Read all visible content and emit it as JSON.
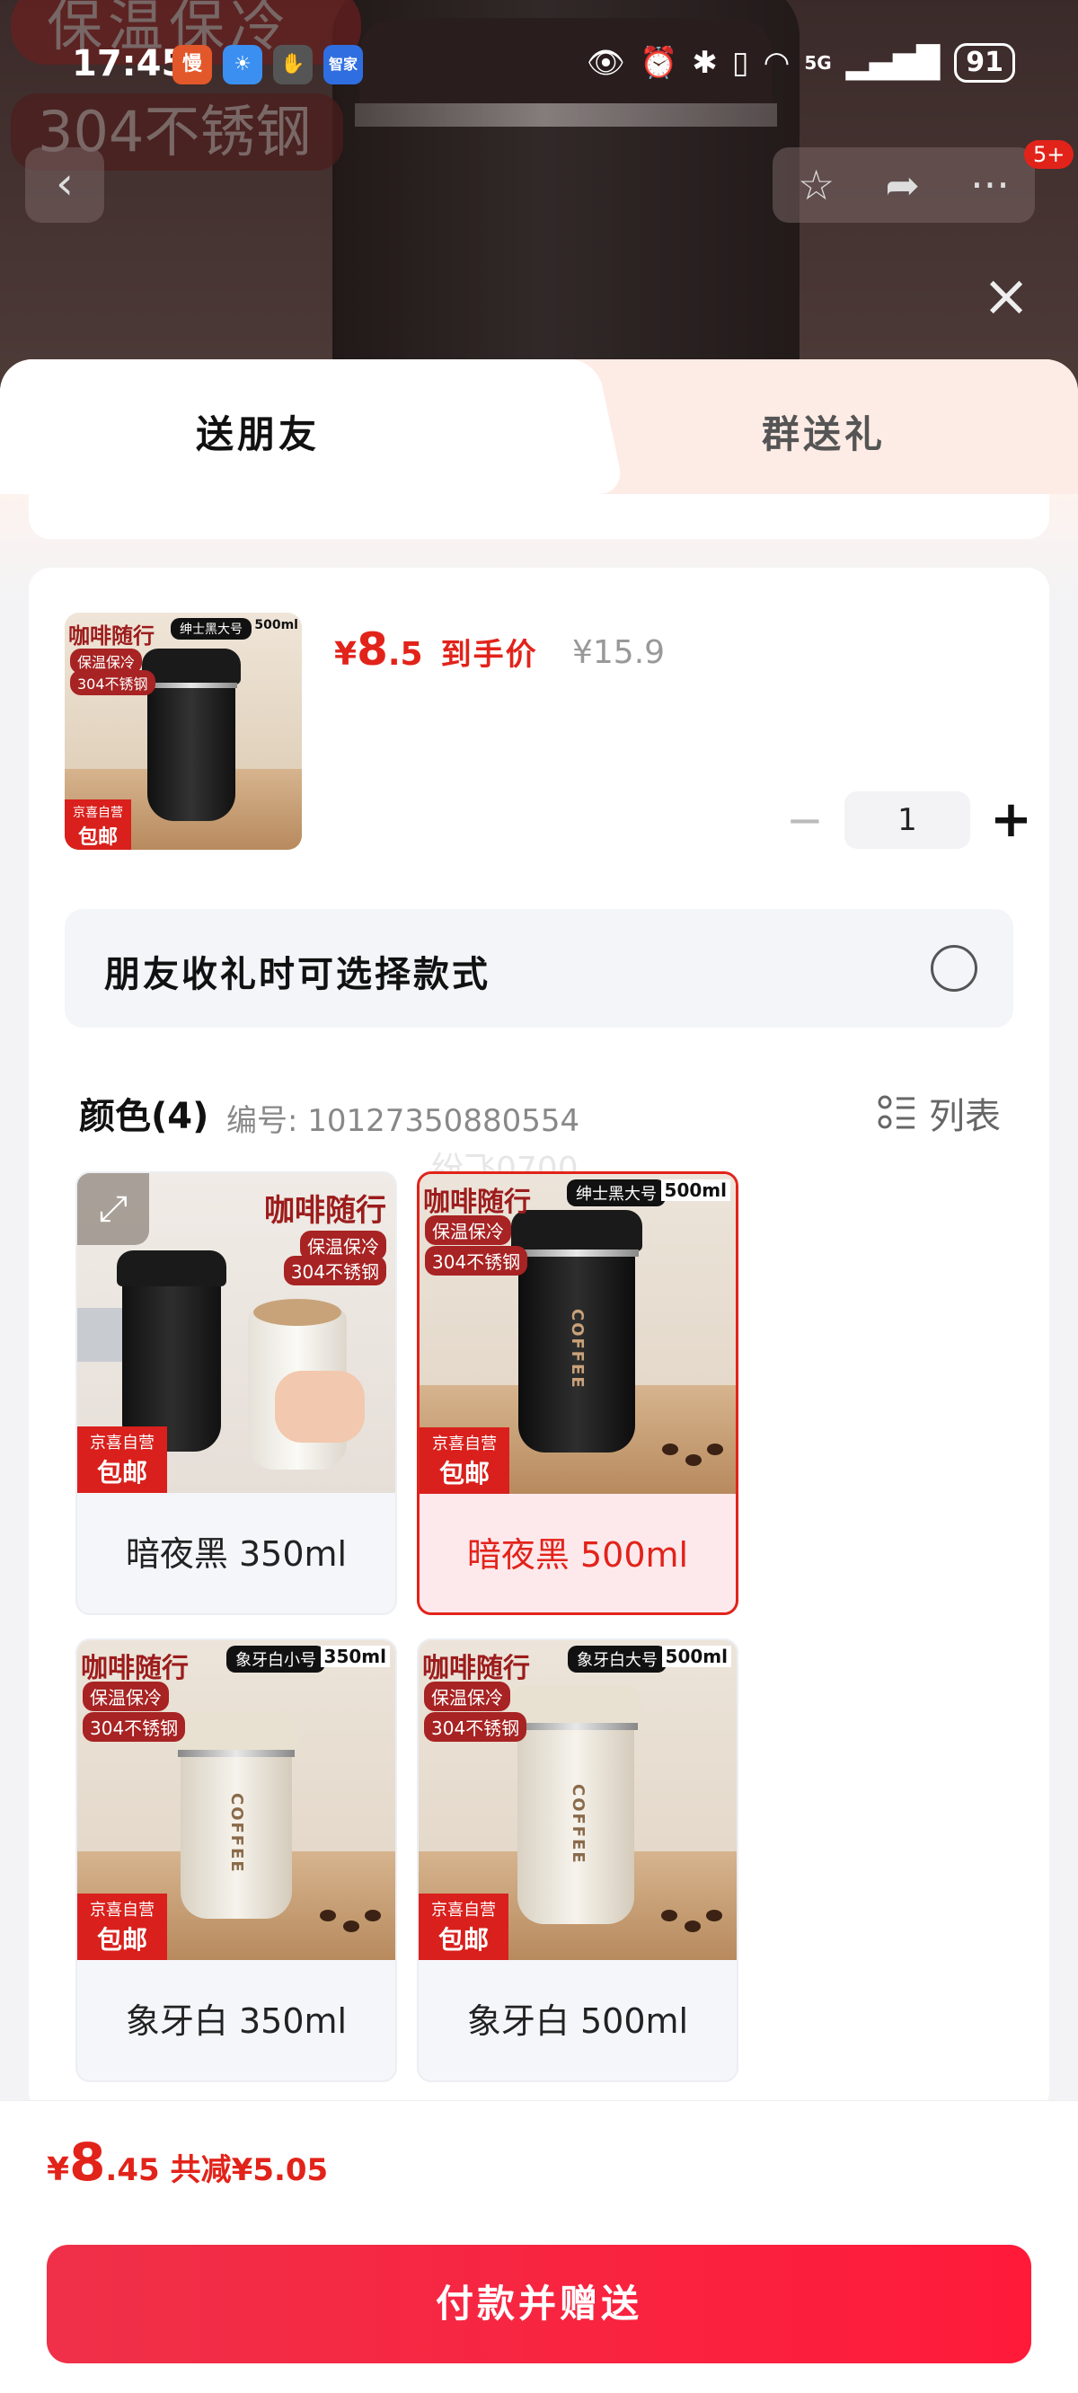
{
  "status_bar": {
    "time": "17:45",
    "battery": "91",
    "network": "5G"
  },
  "background": {
    "tag1": "保温保冷",
    "tag2": "304不锈钢"
  },
  "nav": {
    "badge": "5+"
  },
  "tabs": [
    {
      "label": "送朋友",
      "active": true
    },
    {
      "label": "群送礼",
      "active": false
    }
  ],
  "product": {
    "price_symbol": "¥",
    "price_int": "8",
    "price_dec": ".5",
    "price_tag": "到手价",
    "original_price": "¥15.9",
    "quantity": "1",
    "thumb_title": "咖啡随行",
    "thumb_sub1": "保温保冷",
    "thumb_sub2": "304不锈钢",
    "thumb_size": "绅士黑大号",
    "thumb_ml": "500ml",
    "jd_line1": "京喜自营",
    "jd_line2": "包邮"
  },
  "friend_option": {
    "text": "朋友收礼时可选择款式"
  },
  "color_section": {
    "title": "颜色(4)",
    "sku": "编号: 10127350880554",
    "list_label": "列表",
    "watermark": "纷飞0700"
  },
  "variants": [
    {
      "label": "暗夜黑 350ml",
      "selected": false,
      "cup": "black",
      "size_tag": "",
      "ml": "",
      "has_expand": true
    },
    {
      "label": "暗夜黑 500ml",
      "selected": true,
      "cup": "black",
      "size_tag": "绅士黑大号",
      "ml": "500ml",
      "has_expand": false
    },
    {
      "label": "象牙白 350ml",
      "selected": false,
      "cup": "white",
      "size_tag": "象牙白小号",
      "ml": "350ml",
      "has_expand": false
    },
    {
      "label": "象牙白 500ml",
      "selected": false,
      "cup": "white",
      "size_tag": "象牙白大号",
      "ml": "500ml",
      "has_expand": false
    }
  ],
  "variant_common": {
    "title": "咖啡随行",
    "sub1": "保温保冷",
    "sub2": "304不锈钢",
    "jd_line1": "京喜自营",
    "jd_line2": "包邮",
    "coffee": "COFFEE"
  },
  "footer": {
    "symbol": "¥",
    "total_int": "8",
    "total_dec": ".45",
    "savings": "共减¥5.05",
    "pay_button": "付款并赠送"
  },
  "colors": {
    "accent": "#e2231a",
    "button": "#f03048"
  }
}
